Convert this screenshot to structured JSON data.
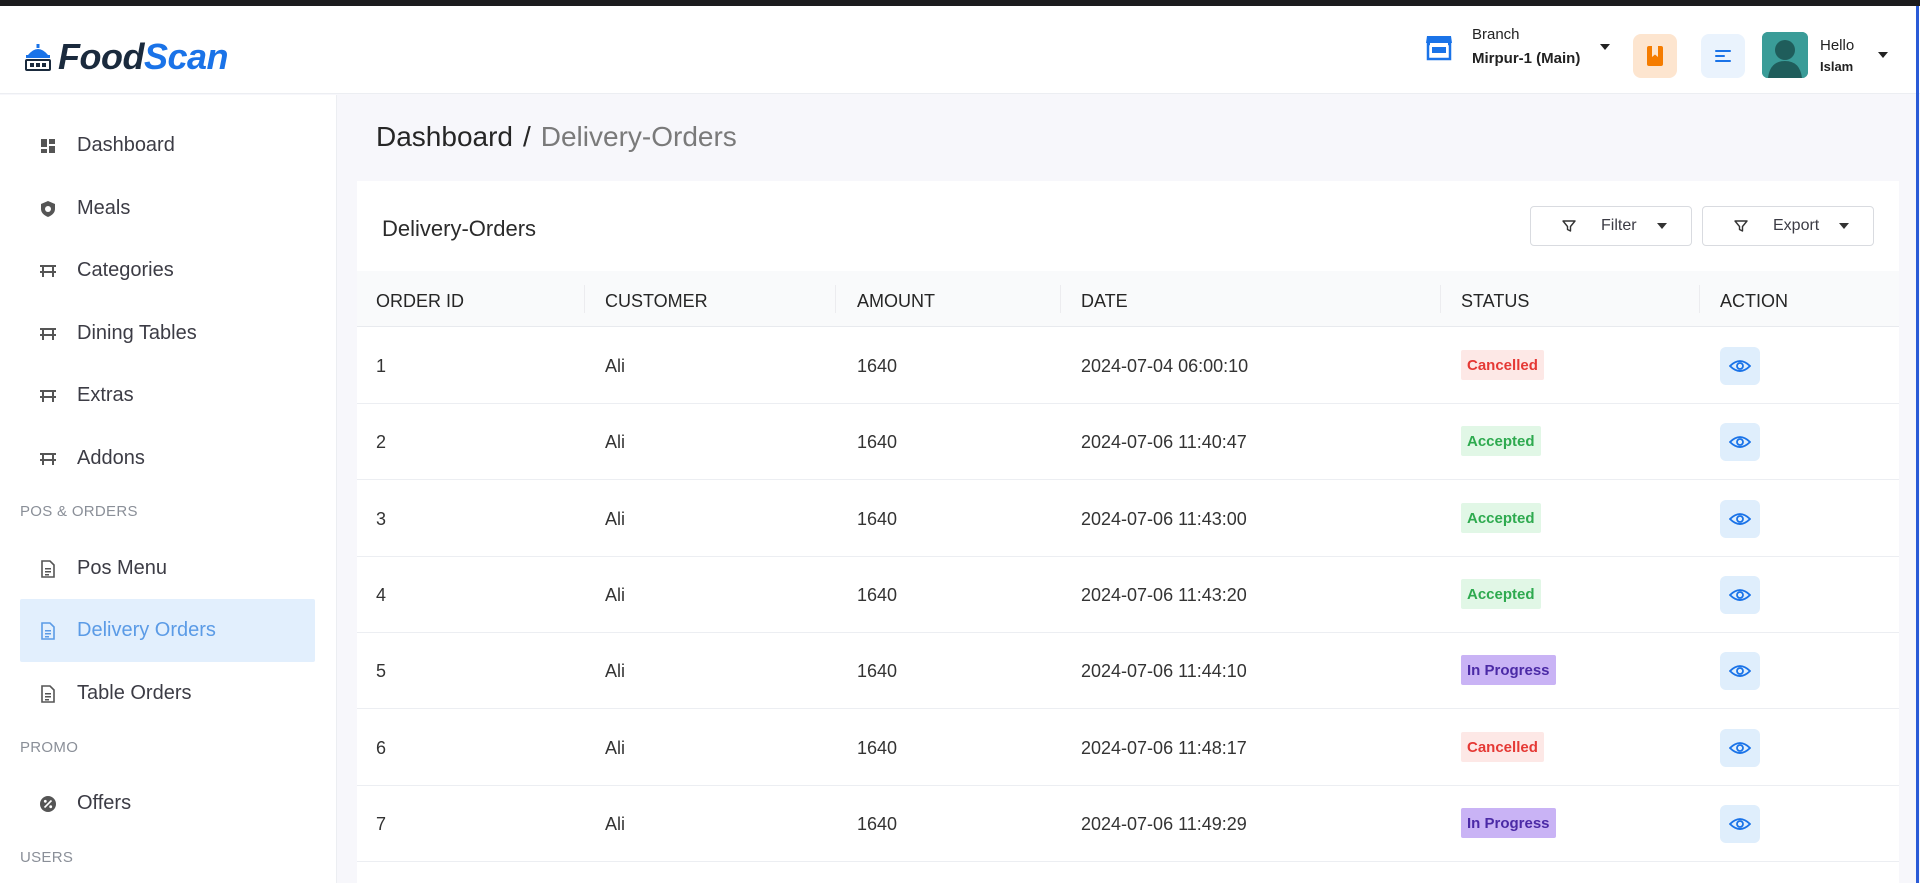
{
  "app": {
    "logo_part1": "Food",
    "logo_part2": "Scan"
  },
  "header": {
    "branch_label": "Branch",
    "branch_value": "Mirpur-1 (Main)",
    "greeting": "Hello",
    "user_name": "Islam"
  },
  "sidebar": {
    "items": [
      {
        "label": "Dashboard",
        "icon": "dashboard-icon"
      },
      {
        "label": "Meals",
        "icon": "meals-icon"
      },
      {
        "label": "Categories",
        "icon": "table-icon"
      },
      {
        "label": "Dining Tables",
        "icon": "table-icon"
      },
      {
        "label": "Extras",
        "icon": "table-icon"
      },
      {
        "label": "Addons",
        "icon": "table-icon"
      }
    ],
    "section_pos": "POS & ORDERS",
    "pos_items": [
      {
        "label": "Pos Menu",
        "icon": "document-icon"
      },
      {
        "label": "Delivery Orders",
        "icon": "document-icon",
        "active": true
      },
      {
        "label": "Table Orders",
        "icon": "document-icon"
      }
    ],
    "section_promo": "PROMO",
    "promo_items": [
      {
        "label": "Offers",
        "icon": "offer-icon"
      }
    ],
    "section_users": "USERS"
  },
  "breadcrumb": {
    "root": "Dashboard",
    "separator": "/",
    "current": "Delivery-Orders"
  },
  "card": {
    "title": "Delivery-Orders",
    "filter_label": "Filter",
    "export_label": "Export"
  },
  "table": {
    "headers": [
      "ORDER ID",
      "CUSTOMER",
      "AMOUNT",
      "DATE",
      "STATUS",
      "ACTION"
    ],
    "rows": [
      {
        "id": "1",
        "customer": "Ali",
        "amount": "1640",
        "date": "2024-07-04 06:00:10",
        "status": "Cancelled"
      },
      {
        "id": "2",
        "customer": "Ali",
        "amount": "1640",
        "date": "2024-07-06 11:40:47",
        "status": "Accepted"
      },
      {
        "id": "3",
        "customer": "Ali",
        "amount": "1640",
        "date": "2024-07-06 11:43:00",
        "status": "Accepted"
      },
      {
        "id": "4",
        "customer": "Ali",
        "amount": "1640",
        "date": "2024-07-06 11:43:20",
        "status": "Accepted"
      },
      {
        "id": "5",
        "customer": "Ali",
        "amount": "1640",
        "date": "2024-07-06 11:44:10",
        "status": "In Progress"
      },
      {
        "id": "6",
        "customer": "Ali",
        "amount": "1640",
        "date": "2024-07-06 11:48:17",
        "status": "Cancelled"
      },
      {
        "id": "7",
        "customer": "Ali",
        "amount": "1640",
        "date": "2024-07-06 11:49:29",
        "status": "In Progress"
      }
    ]
  },
  "colors": {
    "accent": "#1a73e8",
    "active_bg": "#e2effd",
    "cancelled": "#e53935",
    "accepted": "#2eaa4f",
    "in_progress": "#4b2aa6"
  }
}
